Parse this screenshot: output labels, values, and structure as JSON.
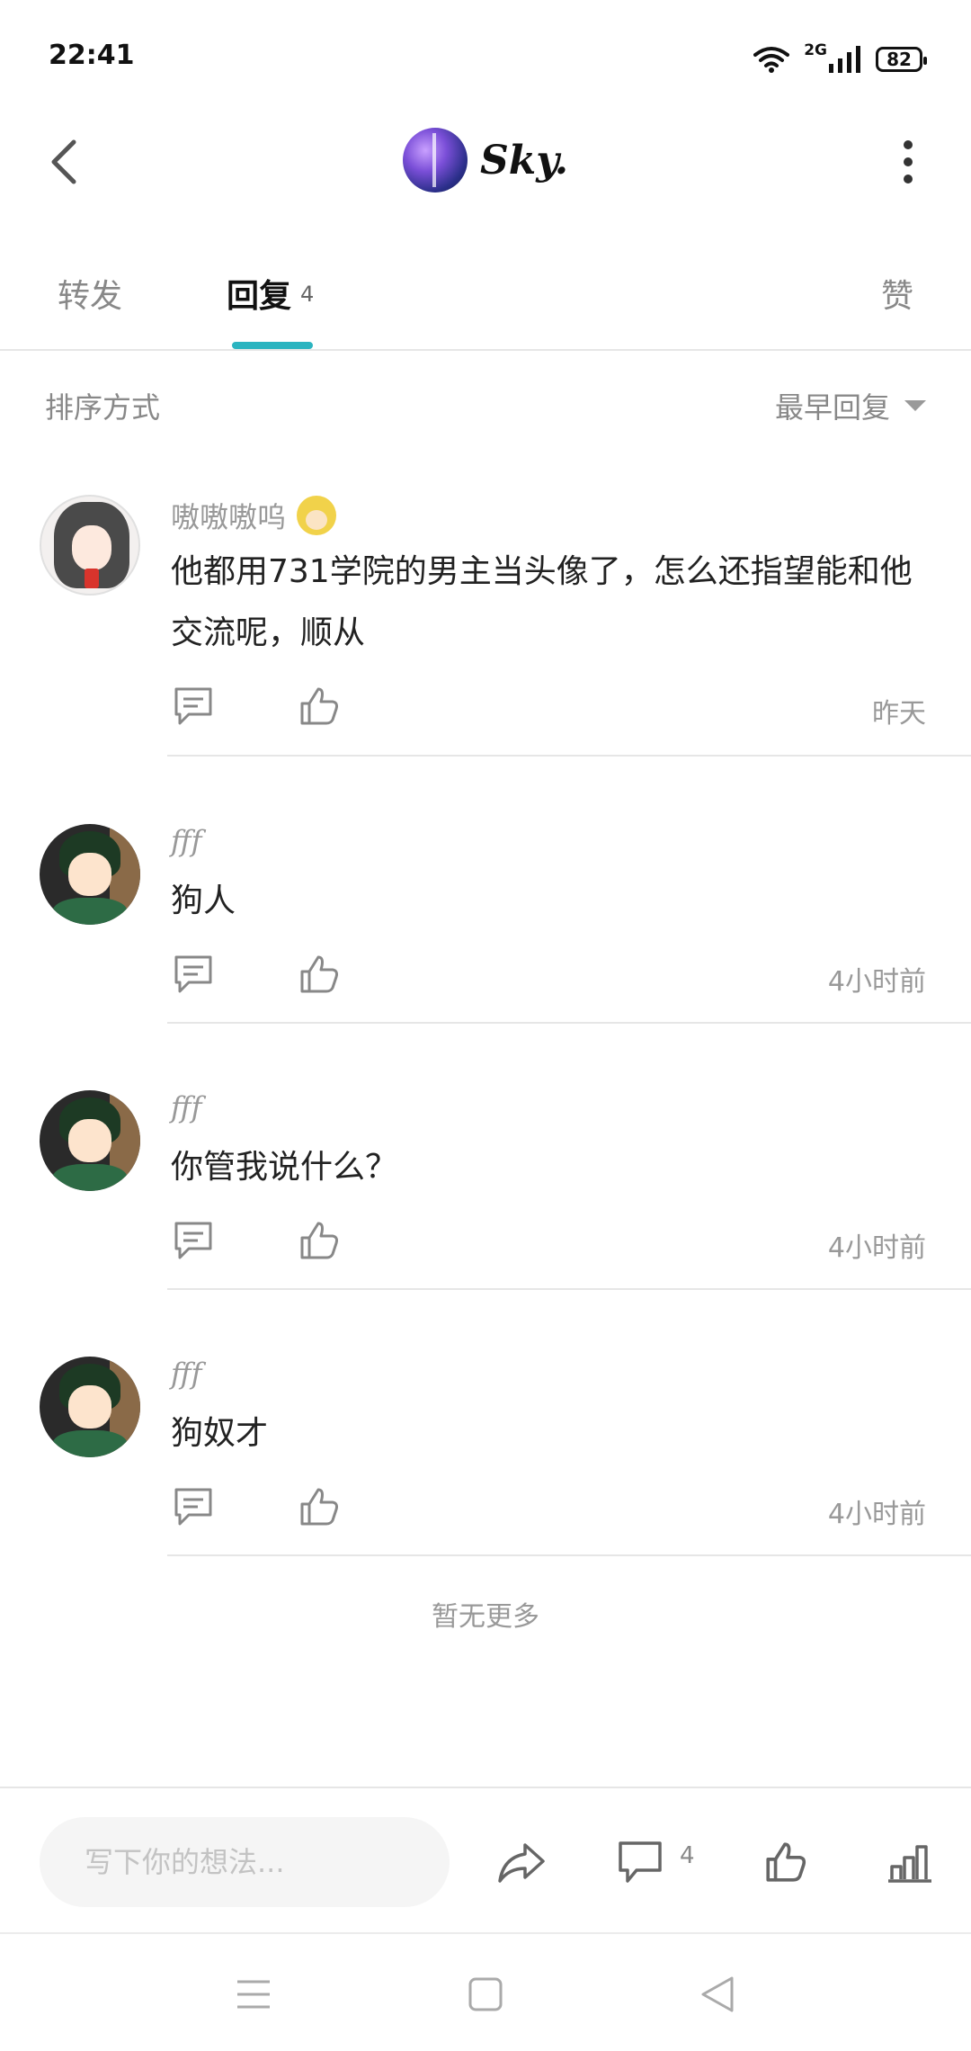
{
  "status_bar": {
    "time": "22:41",
    "network": "2G",
    "battery": "82"
  },
  "header": {
    "title": "Sky."
  },
  "tabs": {
    "repost": "转发",
    "reply": "回复",
    "reply_count": "4",
    "like": "赞",
    "active": "reply",
    "accent_color": "#2bb4c0"
  },
  "sort": {
    "label": "排序方式",
    "value": "最早回复"
  },
  "comments": [
    {
      "author": "嗷嗷嗷呜",
      "text": "他都用731学院的男主当头像了，怎么还指望能和他交流呢，顺从",
      "time": "昨天",
      "avatar": "anime-girl-avatar"
    },
    {
      "author": "fff",
      "text": "狗人",
      "time": "4小时前",
      "avatar": "anime-boy-avatar"
    },
    {
      "author": "fff",
      "text": "你管我说什么？",
      "time": "4小时前",
      "avatar": "anime-boy-avatar"
    },
    {
      "author": "fff",
      "text": "狗奴才",
      "time": "4小时前",
      "avatar": "anime-boy-avatar"
    }
  ],
  "footer": {
    "no_more": "暂无更多"
  },
  "bottom_bar": {
    "input_placeholder": "写下你的想法...",
    "comment_count": "4"
  }
}
